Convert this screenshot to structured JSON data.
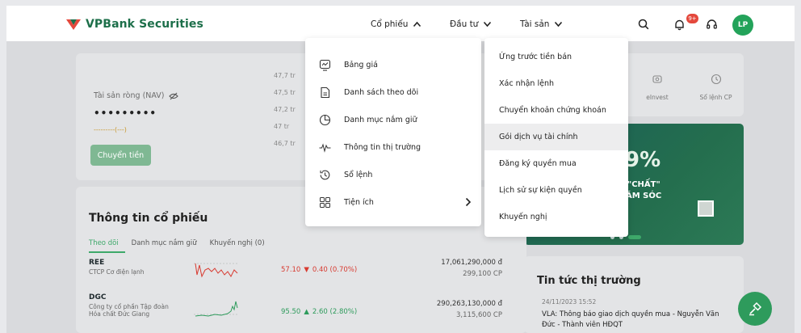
{
  "header": {
    "logo_text": "VPBank Securities",
    "nav": [
      {
        "label": "Cổ phiếu",
        "icon": "chevron-up-icon"
      },
      {
        "label": "Đầu tư",
        "icon": "chevron-down-icon"
      },
      {
        "label": "Tài sản",
        "icon": "chevron-down-icon"
      }
    ],
    "notification_badge": "9+",
    "avatar_initials": "LP"
  },
  "asset_card": {
    "nav_label": "Tài sản ròng (NAV)",
    "masked_value": "•••••••••",
    "sub_value": "---------(---)",
    "transfer_button": "Chuyển tiền",
    "axis_values": [
      "47,7 tr",
      "47,5 tr",
      "47,2 tr",
      "47 tr",
      "46,7 tr"
    ]
  },
  "shortcuts": [
    {
      "label": "eInvest",
      "icon": "einvest-icon"
    },
    {
      "label": "Sổ lệnh CP",
      "icon": "order-book-icon"
    }
  ],
  "stock_info": {
    "title": "Thông tin cổ phiếu",
    "tabs": [
      "Theo dõi",
      "Danh mục nắm giữ",
      "Khuyến nghị (0)"
    ],
    "rows": [
      {
        "symbol": "REE",
        "name": "CTCP Cơ điện lạnh",
        "price": "57.10",
        "change": "0.40 (0.70%)",
        "direction": "down",
        "value": "17,061,290,000 đ",
        "volume": "299,100 CP"
      },
      {
        "symbol": "DGC",
        "name": "Công ty cổ phần Tập đoàn Hóa chất Đức Giang",
        "price": "95.50",
        "change": "2.60 (2.80%)",
        "direction": "up",
        "value": "290,263,130,000 đ",
        "volume": "3,115,600 CP"
      }
    ]
  },
  "banner": {
    "text1": "9%",
    "text2": "\"CHẤT\"",
    "text3": "ĂM SÓC"
  },
  "news": {
    "title": "Tin tức thị trường",
    "items": [
      {
        "time": "24/11/2023 15:52",
        "headline": "VLA: Thông báo giao dịch quyền mua - Nguyễn Văn Đức - Thành viên HĐQT"
      }
    ]
  },
  "stock_menu": {
    "items": [
      {
        "label": "Bảng giá",
        "icon": "price-board-icon"
      },
      {
        "label": "Danh sách theo dõi",
        "icon": "watchlist-icon"
      },
      {
        "label": "Danh mục nắm giữ",
        "icon": "portfolio-icon"
      },
      {
        "label": "Thông tin thị trường",
        "icon": "market-pulse-icon"
      },
      {
        "label": "Sổ lệnh",
        "icon": "history-icon"
      },
      {
        "label": "Tiện ích",
        "icon": "utilities-icon"
      }
    ]
  },
  "submenu": {
    "items": [
      {
        "label": "Ứng trước tiền bán"
      },
      {
        "label": "Xác nhận lệnh"
      },
      {
        "label": "Chuyển khoản chứng khoán"
      },
      {
        "label": "Gói dịch vụ tài chính"
      },
      {
        "label": "Đăng ký quyền mua"
      },
      {
        "label": "Lịch sử sự kiện quyền"
      },
      {
        "label": "Khuyến nghị"
      }
    ]
  },
  "colors": {
    "brand_green": "#1d6f4a",
    "accent_green": "#3ea96a",
    "down_red": "#e4483c",
    "up_green": "#2e9b5c"
  }
}
